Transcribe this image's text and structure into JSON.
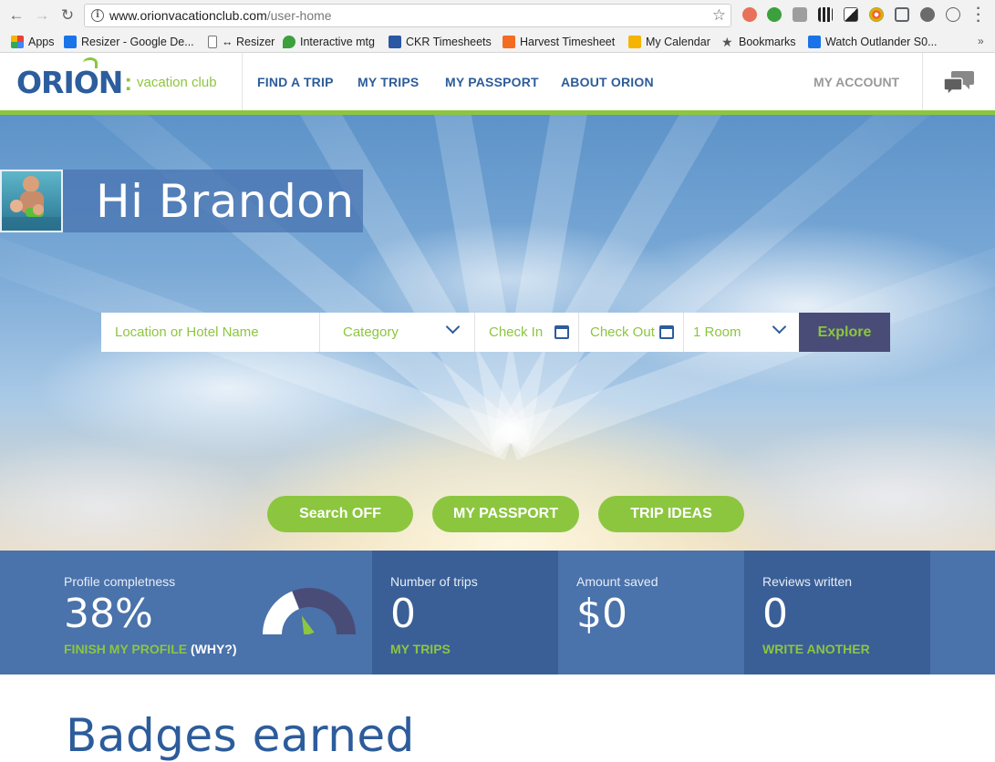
{
  "browser": {
    "url_domain": "www.orionvacationclub.com",
    "url_path": "/user-home",
    "bookmarks": [
      {
        "label": "Apps",
        "icon": "apps-grid-icon",
        "color": "#e94235"
      },
      {
        "label": "Resizer - Google De...",
        "icon": "gd-icon",
        "color": "#1a73e8"
      },
      {
        "label": "↔ Resizer",
        "icon": "page-icon",
        "color": "#ffffff"
      },
      {
        "label": "Interactive mtg",
        "icon": "leaf-icon",
        "color": "#3ca03c"
      },
      {
        "label": "CKR Timesheets",
        "icon": "ckr-icon",
        "color": "#2b57a3"
      },
      {
        "label": "Harvest Timesheet",
        "icon": "harvest-icon",
        "color": "#f36c21"
      },
      {
        "label": "My Calendar",
        "icon": "calendar-icon",
        "color": "#f4b400"
      },
      {
        "label": "Bookmarks",
        "icon": "star-icon",
        "color": "#555555"
      },
      {
        "label": "Watch Outlander S0...",
        "icon": "tv-icon",
        "color": "#1a73e8"
      }
    ]
  },
  "header": {
    "logo_word": "ORION",
    "logo_tagline": "vacation club",
    "nav": [
      "FIND A TRIP",
      "MY TRIPS",
      "MY PASSPORT",
      "ABOUT ORION"
    ],
    "account": "MY ACCOUNT"
  },
  "hero": {
    "greeting": "Hi Brandon",
    "search": {
      "location_placeholder": "Location or Hotel Name",
      "category": "Category",
      "check_in": "Check In",
      "check_out": "Check Out",
      "rooms": "1 Room",
      "explore": "Explore"
    },
    "buttons": [
      "Search OFF",
      "MY PASSPORT",
      "TRIP IDEAS"
    ]
  },
  "stats": {
    "profile": {
      "label": "Profile completness",
      "value": "38%",
      "link": "FINISH MY PROFILE",
      "why": "(WHY?)",
      "percent": 38
    },
    "trips": {
      "label": "Number of trips",
      "value": "0",
      "link": "MY TRIPS"
    },
    "saved": {
      "label": "Amount saved",
      "value": "$0"
    },
    "reviews": {
      "label": "Reviews written",
      "value": "0",
      "link": "WRITE ANOTHER"
    }
  },
  "badges": {
    "title": "Badges earned"
  },
  "colors": {
    "brand_blue": "#2d5c9b",
    "brand_green": "#8cc63f",
    "explore_bg": "#4a4c78"
  }
}
